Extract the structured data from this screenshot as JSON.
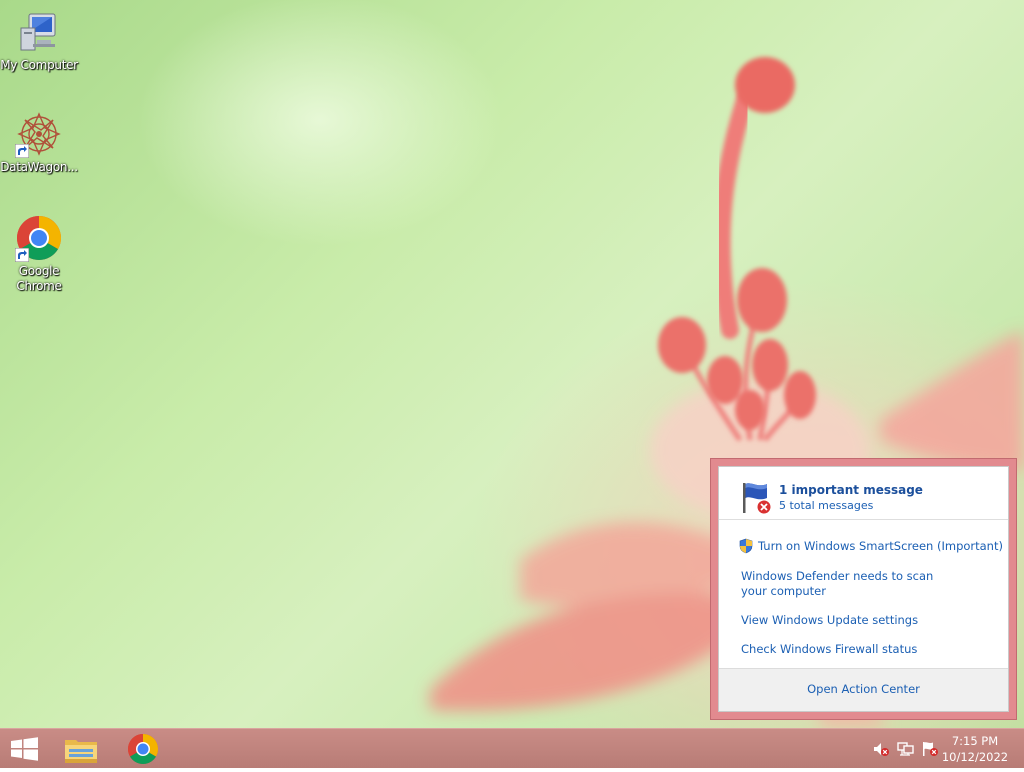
{
  "desktop": {
    "icons": [
      {
        "label": "My Computer",
        "icon": "computer-icon"
      },
      {
        "label": "DataWagon...",
        "icon": "datawagon-icon"
      },
      {
        "label": "Google Chrome",
        "icon": "chrome-icon"
      }
    ]
  },
  "action_center": {
    "title": "1 important message",
    "subtitle": "5 total messages",
    "messages": [
      {
        "text": "Turn on Windows SmartScreen (Important)",
        "icon": "shield-icon"
      },
      {
        "text": "Windows Defender needs to scan your computer"
      },
      {
        "text": "View Windows Update settings"
      },
      {
        "text": "Check Windows Firewall status"
      }
    ],
    "footer_link": "Open Action Center",
    "border_color": "#e28a8f"
  },
  "taskbar": {
    "color": "#c08580",
    "pinned": [
      {
        "icon": "windows-start-icon"
      },
      {
        "icon": "file-explorer-icon"
      },
      {
        "icon": "chrome-icon"
      }
    ],
    "tray": [
      {
        "icon": "speaker-muted-icon"
      },
      {
        "icon": "network-error-icon"
      },
      {
        "icon": "action-center-flag-icon"
      }
    ],
    "clock": {
      "time": "7:15 PM",
      "date": "10/12/2022"
    }
  }
}
